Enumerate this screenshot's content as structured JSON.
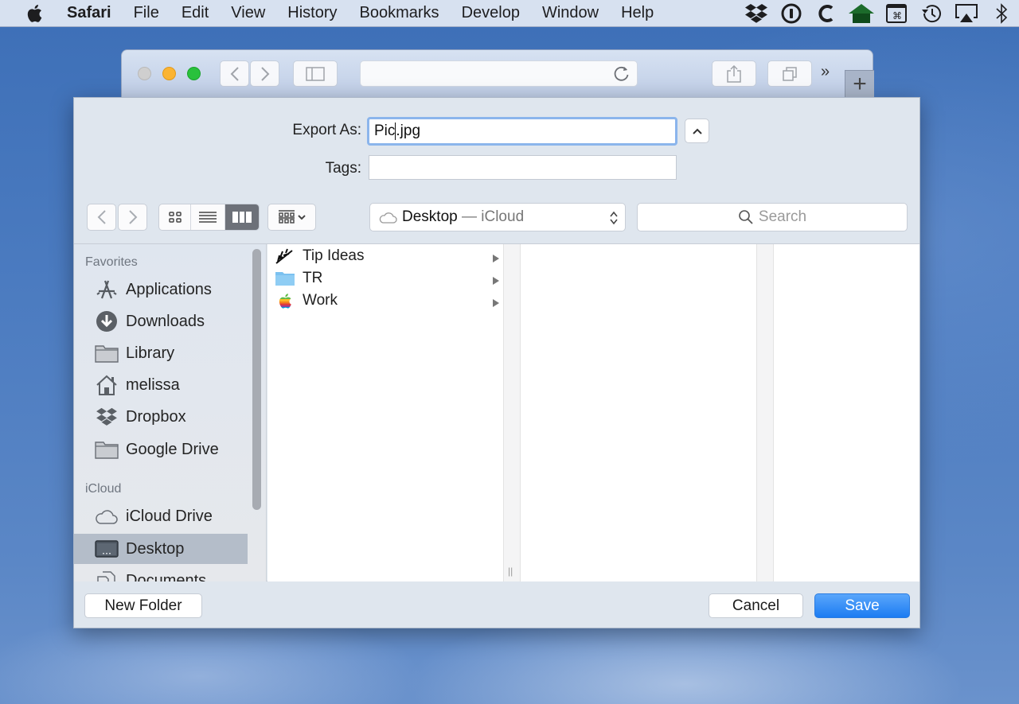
{
  "menubar": {
    "apple_icon": "apple-logo-icon",
    "items": [
      {
        "label": "Safari",
        "bold": true
      },
      {
        "label": "File"
      },
      {
        "label": "Edit"
      },
      {
        "label": "View"
      },
      {
        "label": "History"
      },
      {
        "label": "Bookmarks"
      },
      {
        "label": "Develop"
      },
      {
        "label": "Window"
      },
      {
        "label": "Help"
      }
    ],
    "status_icons": [
      "dropbox-icon",
      "1password-icon",
      "c-app-icon",
      "home-icon",
      "command-window-icon",
      "time-machine-icon",
      "airplay-icon",
      "bluetooth-icon"
    ]
  },
  "safari_toolbar": {
    "traffic_colors": {
      "close": "#cfcfcf",
      "minimize": "#fbb433",
      "maximize": "#29c13c"
    },
    "url_value": "",
    "overflow_label": "»",
    "new_tab_label": "+"
  },
  "save_dialog": {
    "export_label": "Export As:",
    "filename_before_caret": "Pic",
    "filename_after_caret": ".jpg",
    "tags_label": "Tags:",
    "tags_value": "",
    "location": {
      "name": "Desktop",
      "separator": " — ",
      "service": "iCloud"
    },
    "search_placeholder": "Search",
    "view_modes": [
      "icon",
      "list",
      "column"
    ],
    "active_view": "column",
    "sidebar": {
      "sections": [
        {
          "title": "Favorites",
          "items": [
            {
              "label": "Applications",
              "icon": "applications-icon"
            },
            {
              "label": "Downloads",
              "icon": "downloads-icon"
            },
            {
              "label": "Library",
              "icon": "folder-icon"
            },
            {
              "label": "melissa",
              "icon": "home-icon"
            },
            {
              "label": "Dropbox",
              "icon": "dropbox-icon"
            },
            {
              "label": "Google Drive",
              "icon": "folder-icon"
            }
          ]
        },
        {
          "title": "iCloud",
          "items": [
            {
              "label": "iCloud Drive",
              "icon": "cloud-icon"
            },
            {
              "label": "Desktop",
              "icon": "desktop-icon",
              "selected": true
            },
            {
              "label": "Documents",
              "icon": "documents-icon"
            }
          ]
        }
      ]
    },
    "files": [
      {
        "name": "Tip Ideas",
        "icon": "custom-folder-icon",
        "has_children": true
      },
      {
        "name": "TR",
        "icon": "folder-icon",
        "has_children": true
      },
      {
        "name": "Work",
        "icon": "apple-rainbow-icon",
        "has_children": true
      }
    ],
    "buttons": {
      "new_folder": "New Folder",
      "cancel": "Cancel",
      "save": "Save"
    },
    "accent_color": "#1c7cf2"
  }
}
